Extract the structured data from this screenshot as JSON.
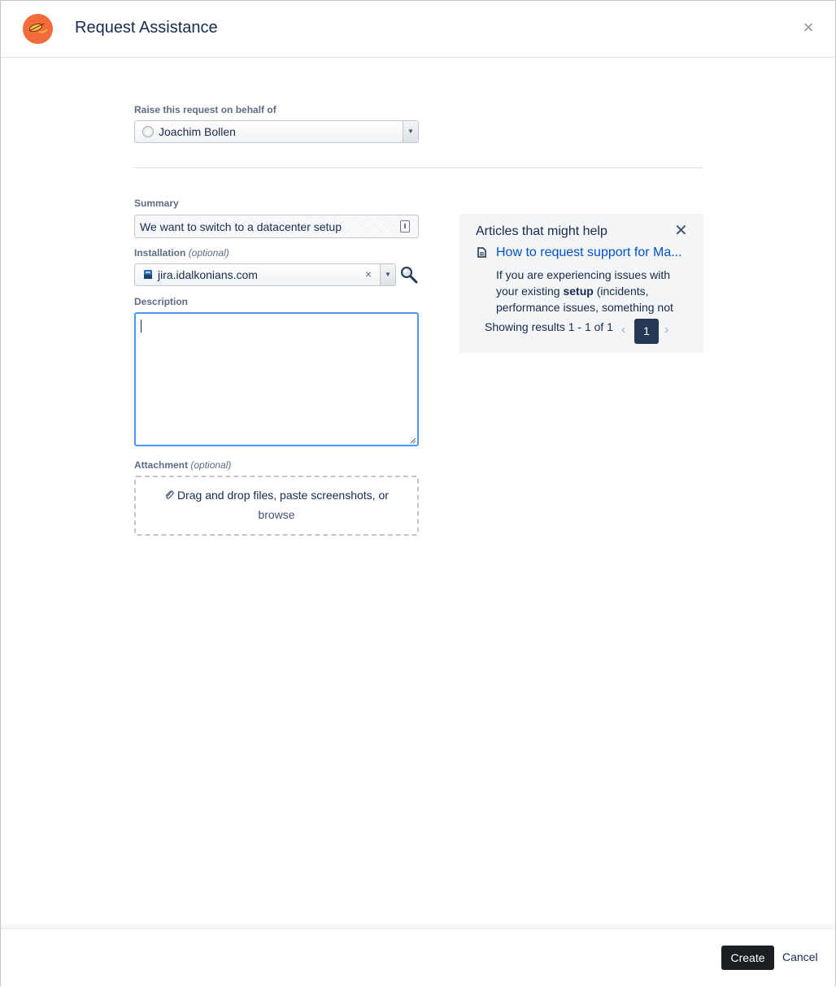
{
  "header": {
    "title": "Request Assistance",
    "logo_icon": "orange-circle-logo",
    "close_icon": "close-icon",
    "close_glyph": "×"
  },
  "form": {
    "behalf": {
      "label": "Raise this request on behalf of",
      "value": "Joachim Bollen",
      "arrow": "▼"
    },
    "summary": {
      "label": "Summary",
      "value": "We want to switch to a datacenter setup"
    },
    "installation": {
      "label": "Installation",
      "optional": "(optional)",
      "value": "jira.idalkonians.com",
      "clear_glyph": "×",
      "arrow": "▼"
    },
    "description": {
      "label": "Description",
      "value": ""
    },
    "attachment": {
      "label": "Attachment",
      "optional": "(optional)",
      "drop_text": "Drag and drop files, paste screenshots, or",
      "browse_text": "browse"
    }
  },
  "articles": {
    "title": "Articles that might help",
    "close_glyph": "✕",
    "items": [
      {
        "title": "How to request support for Ma...",
        "snippet_before": "If you are experiencing issues with your existing ",
        "snippet_bold": "setup",
        "snippet_after": " (incidents, performance issues, something not"
      }
    ],
    "results_text": "Showing results 1 - 1 of 1",
    "current_page": "1",
    "prev_glyph": "‹",
    "next_glyph": "›"
  },
  "footer": {
    "create_label": "Create",
    "cancel_label": "Cancel"
  },
  "colors": {
    "accent": "#0052cc",
    "focus_border": "#4c9aff",
    "logo": "#f26b3a",
    "primary_button": "#1b1f24",
    "page_active": "#253858"
  }
}
